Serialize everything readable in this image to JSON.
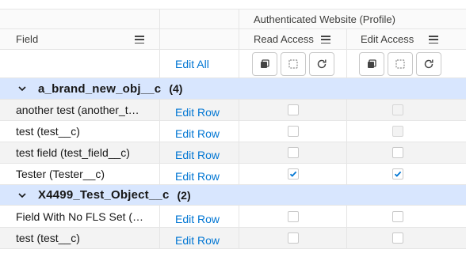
{
  "header": {
    "profile_label": "Authenticated Website (Profile)",
    "field_col": "Field",
    "read_access": "Read Access",
    "edit_access": "Edit Access"
  },
  "toolbar": {
    "edit_all": "Edit All"
  },
  "groups": [
    {
      "name": "a_brand_new_obj__c",
      "count": "(4)",
      "rows": [
        {
          "field": "another test (another_t…",
          "edit": "Edit Row",
          "read": false,
          "edit_access": false,
          "edit_disabled": true
        },
        {
          "field": "test (test__c)",
          "edit": "Edit Row",
          "read": false,
          "edit_access": false,
          "edit_disabled": true
        },
        {
          "field": "test field (test_field__c)",
          "edit": "Edit Row",
          "read": false,
          "edit_access": false,
          "edit_disabled": false
        },
        {
          "field": "Tester (Tester__c)",
          "edit": "Edit Row",
          "read": true,
          "edit_access": true,
          "edit_disabled": false
        }
      ]
    },
    {
      "name": "X4499_Test_Object__c",
      "count": "(2)",
      "rows": [
        {
          "field": "Field With No FLS Set (…",
          "edit": "Edit Row",
          "read": false,
          "edit_access": false,
          "edit_disabled": false
        },
        {
          "field": "test (test__c)",
          "edit": "Edit Row",
          "read": false,
          "edit_access": false,
          "edit_disabled": false
        }
      ]
    }
  ],
  "icons": {
    "copy": "copy-icon",
    "clear": "clear-selection-icon",
    "reset": "reset-icon",
    "chevron": "chevron-down-icon",
    "check": "checkmark-icon"
  },
  "colors": {
    "link": "#0176d3",
    "group_bg": "#d8e6fe",
    "header_bg": "#fafafa",
    "row_gray": "#f3f3f3",
    "border": "#e5e5e5"
  }
}
